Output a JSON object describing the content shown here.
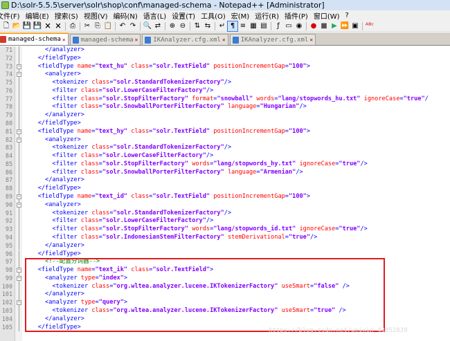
{
  "window": {
    "title": "D:\\solr-5.5.5\\server\\solr\\shop\\conf\\managed-schema - Notepad++ [Administrator]"
  },
  "menu": [
    "文件(F)",
    "编辑(E)",
    "搜索(S)",
    "视图(V)",
    "编码(N)",
    "语言(L)",
    "设置(T)",
    "工具(O)",
    "宏(M)",
    "运行(R)",
    "插件(P)",
    "窗口(W)",
    "?"
  ],
  "toolbar": [
    "new-file",
    "open-file",
    "save",
    "save-all",
    "close",
    "close-all",
    "print",
    "cut",
    "copy",
    "paste",
    "undo",
    "redo",
    "find",
    "replace",
    "zoom-in",
    "zoom-out",
    "sync-scroll-v",
    "sync-scroll-h",
    "word-wrap",
    "show-all-chars",
    "indent-guide",
    "user-defined-lang",
    "doc-map",
    "function-list",
    "folder-as-workspace",
    "monitoring",
    "record-macro",
    "stop-macro",
    "play-macro",
    "run-macro-multiple",
    "save-macro",
    "spell-check"
  ],
  "tabs": [
    {
      "label": "managed-schema",
      "active": true
    },
    {
      "label": "managed-schema",
      "active": false
    },
    {
      "label": "IKAnalyzer.cfg.xml",
      "active": false
    },
    {
      "label": "IKAnalyzer.cfg.xml",
      "active": false
    }
  ],
  "lines": [
    {
      "n": "71",
      "fold": "line",
      "segs": [
        [
          "t",
          "      </analyzer>"
        ]
      ]
    },
    {
      "n": "72",
      "fold": "line",
      "segs": [
        [
          "t",
          "    </fieldType>"
        ]
      ]
    },
    {
      "n": "73",
      "fold": "minus",
      "segs": [
        [
          "t",
          "    <fieldType "
        ],
        [
          "a",
          "name"
        ],
        [
          "t",
          "="
        ],
        [
          "v",
          "\"text_hu\""
        ],
        [
          "t",
          " "
        ],
        [
          "a",
          "class"
        ],
        [
          "t",
          "="
        ],
        [
          "v",
          "\"solr.TextField\""
        ],
        [
          "t",
          " "
        ],
        [
          "a",
          "positionIncrementGap"
        ],
        [
          "t",
          "="
        ],
        [
          "v",
          "\"100\""
        ],
        [
          "t",
          ">"
        ]
      ]
    },
    {
      "n": "74",
      "fold": "minus",
      "segs": [
        [
          "t",
          "      <analyzer>"
        ]
      ]
    },
    {
      "n": "75",
      "fold": "line",
      "segs": [
        [
          "t",
          "        <tokenizer "
        ],
        [
          "a",
          "class"
        ],
        [
          "t",
          "="
        ],
        [
          "v",
          "\"solr.StandardTokenizerFactory\""
        ],
        [
          "t",
          "/>"
        ]
      ]
    },
    {
      "n": "76",
      "fold": "line",
      "segs": [
        [
          "t",
          "        <filter "
        ],
        [
          "a",
          "class"
        ],
        [
          "t",
          "="
        ],
        [
          "v",
          "\"solr.LowerCaseFilterFactory\""
        ],
        [
          "t",
          "/>"
        ]
      ]
    },
    {
      "n": "77",
      "fold": "line",
      "segs": [
        [
          "t",
          "        <filter "
        ],
        [
          "a",
          "class"
        ],
        [
          "t",
          "="
        ],
        [
          "v",
          "\"solr.StopFilterFactory\""
        ],
        [
          "t",
          " "
        ],
        [
          "a",
          "format"
        ],
        [
          "t",
          "="
        ],
        [
          "v",
          "\"snowball\""
        ],
        [
          "t",
          " "
        ],
        [
          "a",
          "words"
        ],
        [
          "t",
          "="
        ],
        [
          "v",
          "\"lang/stopwords_hu.txt\""
        ],
        [
          "t",
          " "
        ],
        [
          "a",
          "ignoreCase"
        ],
        [
          "t",
          "="
        ],
        [
          "v",
          "\"true\""
        ],
        [
          "t",
          "/"
        ]
      ]
    },
    {
      "n": "78",
      "fold": "line",
      "segs": [
        [
          "t",
          "        <filter "
        ],
        [
          "a",
          "class"
        ],
        [
          "t",
          "="
        ],
        [
          "v",
          "\"solr.SnowballPorterFilterFactory\""
        ],
        [
          "t",
          " "
        ],
        [
          "a",
          "language"
        ],
        [
          "t",
          "="
        ],
        [
          "v",
          "\"Hungarian\""
        ],
        [
          "t",
          "/>"
        ]
      ]
    },
    {
      "n": "79",
      "fold": "line",
      "segs": [
        [
          "t",
          "      </analyzer>"
        ]
      ]
    },
    {
      "n": "80",
      "fold": "line",
      "segs": [
        [
          "t",
          "    </fieldType>"
        ]
      ]
    },
    {
      "n": "81",
      "fold": "minus",
      "segs": [
        [
          "t",
          "    <fieldType "
        ],
        [
          "a",
          "name"
        ],
        [
          "t",
          "="
        ],
        [
          "v",
          "\"text_hy\""
        ],
        [
          "t",
          " "
        ],
        [
          "a",
          "class"
        ],
        [
          "t",
          "="
        ],
        [
          "v",
          "\"solr.TextField\""
        ],
        [
          "t",
          " "
        ],
        [
          "a",
          "positionIncrementGap"
        ],
        [
          "t",
          "="
        ],
        [
          "v",
          "\"100\""
        ],
        [
          "t",
          ">"
        ]
      ]
    },
    {
      "n": "82",
      "fold": "minus",
      "segs": [
        [
          "t",
          "      <analyzer>"
        ]
      ]
    },
    {
      "n": "83",
      "fold": "line",
      "segs": [
        [
          "t",
          "        <tokenizer "
        ],
        [
          "a",
          "class"
        ],
        [
          "t",
          "="
        ],
        [
          "v",
          "\"solr.StandardTokenizerFactory\""
        ],
        [
          "t",
          "/>"
        ]
      ]
    },
    {
      "n": "84",
      "fold": "line",
      "segs": [
        [
          "t",
          "        <filter "
        ],
        [
          "a",
          "class"
        ],
        [
          "t",
          "="
        ],
        [
          "v",
          "\"solr.LowerCaseFilterFactory\""
        ],
        [
          "t",
          "/>"
        ]
      ]
    },
    {
      "n": "85",
      "fold": "line",
      "segs": [
        [
          "t",
          "        <filter "
        ],
        [
          "a",
          "class"
        ],
        [
          "t",
          "="
        ],
        [
          "v",
          "\"solr.StopFilterFactory\""
        ],
        [
          "t",
          " "
        ],
        [
          "a",
          "words"
        ],
        [
          "t",
          "="
        ],
        [
          "v",
          "\"lang/stopwords_hy.txt\""
        ],
        [
          "t",
          " "
        ],
        [
          "a",
          "ignoreCase"
        ],
        [
          "t",
          "="
        ],
        [
          "v",
          "\"true\""
        ],
        [
          "t",
          "/>"
        ]
      ]
    },
    {
      "n": "86",
      "fold": "line",
      "segs": [
        [
          "t",
          "        <filter "
        ],
        [
          "a",
          "class"
        ],
        [
          "t",
          "="
        ],
        [
          "v",
          "\"solr.SnowballPorterFilterFactory\""
        ],
        [
          "t",
          " "
        ],
        [
          "a",
          "language"
        ],
        [
          "t",
          "="
        ],
        [
          "v",
          "\"Armenian\""
        ],
        [
          "t",
          "/>"
        ]
      ]
    },
    {
      "n": "87",
      "fold": "line",
      "segs": [
        [
          "t",
          "      </analyzer>"
        ]
      ]
    },
    {
      "n": "88",
      "fold": "line",
      "segs": [
        [
          "t",
          "    </fieldType>"
        ]
      ]
    },
    {
      "n": "89",
      "fold": "minus",
      "segs": [
        [
          "t",
          "    <fieldType "
        ],
        [
          "a",
          "name"
        ],
        [
          "t",
          "="
        ],
        [
          "v",
          "\"text_id\""
        ],
        [
          "t",
          " "
        ],
        [
          "a",
          "class"
        ],
        [
          "t",
          "="
        ],
        [
          "v",
          "\"solr.TextField\""
        ],
        [
          "t",
          " "
        ],
        [
          "a",
          "positionIncrementGap"
        ],
        [
          "t",
          "="
        ],
        [
          "v",
          "\"100\""
        ],
        [
          "t",
          ">"
        ]
      ]
    },
    {
      "n": "90",
      "fold": "minus",
      "segs": [
        [
          "t",
          "      <analyzer>"
        ]
      ]
    },
    {
      "n": "91",
      "fold": "line",
      "segs": [
        [
          "t",
          "        <tokenizer "
        ],
        [
          "a",
          "class"
        ],
        [
          "t",
          "="
        ],
        [
          "v",
          "\"solr.StandardTokenizerFactory\""
        ],
        [
          "t",
          "/>"
        ]
      ]
    },
    {
      "n": "92",
      "fold": "line",
      "segs": [
        [
          "t",
          "        <filter "
        ],
        [
          "a",
          "class"
        ],
        [
          "t",
          "="
        ],
        [
          "v",
          "\"solr.LowerCaseFilterFactory\""
        ],
        [
          "t",
          "/>"
        ]
      ]
    },
    {
      "n": "93",
      "fold": "line",
      "segs": [
        [
          "t",
          "        <filter "
        ],
        [
          "a",
          "class"
        ],
        [
          "t",
          "="
        ],
        [
          "v",
          "\"solr.StopFilterFactory\""
        ],
        [
          "t",
          " "
        ],
        [
          "a",
          "words"
        ],
        [
          "t",
          "="
        ],
        [
          "v",
          "\"lang/stopwords_id.txt\""
        ],
        [
          "t",
          " "
        ],
        [
          "a",
          "ignoreCase"
        ],
        [
          "t",
          "="
        ],
        [
          "v",
          "\"true\""
        ],
        [
          "t",
          "/>"
        ]
      ]
    },
    {
      "n": "94",
      "fold": "line",
      "segs": [
        [
          "t",
          "        <filter "
        ],
        [
          "a",
          "class"
        ],
        [
          "t",
          "="
        ],
        [
          "v",
          "\"solr.IndonesianStemFilterFactory\""
        ],
        [
          "t",
          " "
        ],
        [
          "a",
          "stemDerivational"
        ],
        [
          "t",
          "="
        ],
        [
          "v",
          "\"true\""
        ],
        [
          "t",
          "/>"
        ]
      ]
    },
    {
      "n": "95",
      "fold": "line",
      "segs": [
        [
          "t",
          "      </analyzer>"
        ]
      ]
    },
    {
      "n": "96",
      "fold": "line",
      "segs": [
        [
          "t",
          "    </fieldType>"
        ]
      ]
    },
    {
      "n": "97",
      "fold": "line",
      "segs": [
        [
          "c",
          "      <!--配置分词器-->"
        ]
      ]
    },
    {
      "n": "98",
      "fold": "minus",
      "segs": [
        [
          "t",
          "    <fieldType "
        ],
        [
          "a",
          "name"
        ],
        [
          "t",
          "="
        ],
        [
          "v",
          "\"text_ik\""
        ],
        [
          "t",
          " "
        ],
        [
          "a",
          "class"
        ],
        [
          "t",
          "="
        ],
        [
          "v",
          "\"solr.TextField\""
        ],
        [
          "t",
          ">"
        ]
      ]
    },
    {
      "n": "99",
      "fold": "minus",
      "segs": [
        [
          "t",
          "      <analyzer "
        ],
        [
          "a",
          "type"
        ],
        [
          "t",
          "="
        ],
        [
          "v",
          "\"index\""
        ],
        [
          "t",
          ">"
        ]
      ]
    },
    {
      "n": "100",
      "fold": "line",
      "segs": [
        [
          "t",
          "        <tokenizer "
        ],
        [
          "a",
          "class"
        ],
        [
          "t",
          "="
        ],
        [
          "v",
          "\"org.wltea.analyzer.lucene.IKTokenizerFactory\""
        ],
        [
          "t",
          " "
        ],
        [
          "a",
          "useSmart"
        ],
        [
          "t",
          "="
        ],
        [
          "v",
          "\"false\""
        ],
        [
          "t",
          " />"
        ]
      ]
    },
    {
      "n": "101",
      "fold": "line",
      "segs": [
        [
          "t",
          "      </analyzer>"
        ]
      ]
    },
    {
      "n": "102",
      "fold": "minus",
      "segs": [
        [
          "t",
          "      <analyzer "
        ],
        [
          "a",
          "type"
        ],
        [
          "t",
          "="
        ],
        [
          "v",
          "\"query\""
        ],
        [
          "t",
          ">"
        ]
      ]
    },
    {
      "n": "103",
      "fold": "line",
      "segs": [
        [
          "t",
          "        <tokenizer "
        ],
        [
          "a",
          "class"
        ],
        [
          "t",
          "="
        ],
        [
          "v",
          "\"org.wltea.analyzer.lucene.IKTokenizerFactory\""
        ],
        [
          "t",
          " "
        ],
        [
          "a",
          "useSmart"
        ],
        [
          "t",
          "="
        ],
        [
          "v",
          "\"true\""
        ],
        [
          "t",
          " />"
        ]
      ]
    },
    {
      "n": "104",
      "fold": "line",
      "segs": [
        [
          "t",
          "      </analyzer>"
        ]
      ]
    },
    {
      "n": "105",
      "fold": "line",
      "segs": [
        [
          "t",
          "    </fieldType>"
        ]
      ]
    }
  ],
  "watermark": "https://blog.csdn.net/weixin_43052839",
  "colors": {
    "tag": "#0000ff",
    "attribute": "#ff0000",
    "value": "#8000ff",
    "comment": "#008000",
    "highlight_box": "#e0191c"
  }
}
